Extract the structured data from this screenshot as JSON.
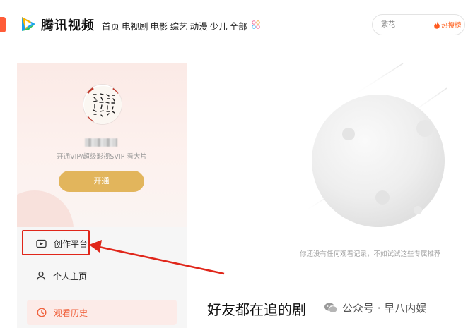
{
  "header": {
    "brand": "腾讯视频",
    "nav": [
      "首页",
      "电视剧",
      "电影",
      "综艺",
      "动漫",
      "少儿",
      "全部"
    ],
    "search": {
      "placeholder": "繁花",
      "hot_label": "热搜榜"
    }
  },
  "sidebar": {
    "vip_text": "开通VIP/超级影视SVIP 看大片",
    "vip_button": "开通",
    "menu": {
      "create": "创作平台",
      "home": "个人主页",
      "history": "观看历史"
    }
  },
  "main": {
    "empty_text": "你还没有任何观看记录，不如试试这些专属推荐",
    "section_title": "好友都在追的剧"
  },
  "watermark": {
    "text": "公众号 · 早八内娱"
  },
  "colors": {
    "accent_orange": "#ff6422",
    "vip_gold": "#e2b55c",
    "highlight_red": "#e0261a",
    "history_accent": "#f0623d"
  },
  "icons": [
    "tencent-video-logo-icon",
    "category-grid-icon",
    "flame-icon",
    "create-platform-icon",
    "user-icon",
    "clock-icon",
    "wechat-icon"
  ]
}
